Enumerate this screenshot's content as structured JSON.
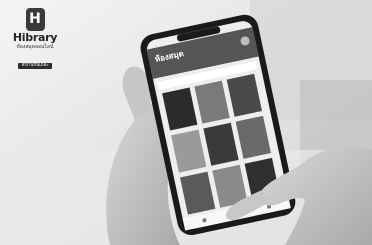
{
  "brand": {
    "icon_letter": "H",
    "name": "Hibrary",
    "subtitle": "ห้องสมุดออนไลน์",
    "tag": "#อ่านกันเถอะ"
  },
  "app_screen": {
    "title": "ห้องสมุด",
    "avatar_icon": "user-avatar-icon"
  },
  "colors": {
    "background": "#ffffff",
    "phone_body": "#1a1a1a",
    "screen": "#eeeeee",
    "brand_dark": "#333333"
  }
}
